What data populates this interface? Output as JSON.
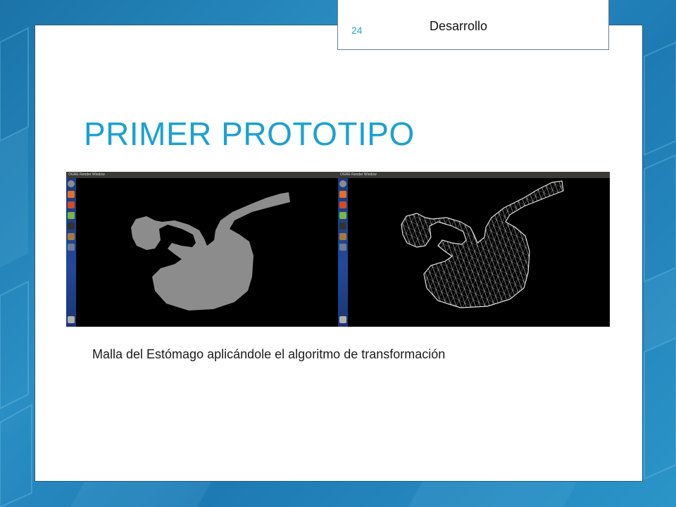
{
  "header": {
    "page_number": "24",
    "section": "Desarrollo"
  },
  "slide": {
    "title": "PRIMER PROTOTIPO",
    "caption": "Malla del Estómago aplicándole el algoritmo de transformación"
  },
  "screenshots": [
    {
      "window_title": "OGRE Render Window",
      "render_mode": "solid"
    },
    {
      "window_title": "OGRE Render Window",
      "render_mode": "wireframe"
    }
  ],
  "colors": {
    "title": "#1ba1d1",
    "page_number": "#2aa6cf",
    "background": "#1e7ab3",
    "solid_mesh": "#8c8c8c",
    "wireframe_mesh": "#d9d9d9"
  }
}
